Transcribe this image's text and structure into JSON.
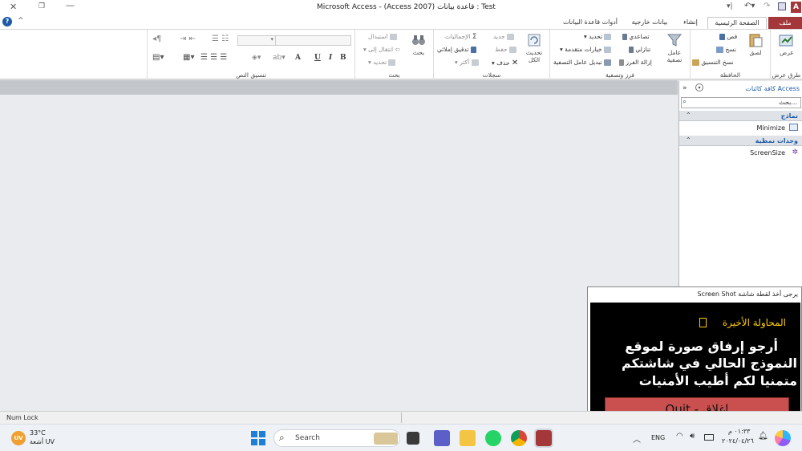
{
  "window": {
    "title": "Microsoft Access - (Access 2007) قاعدة بيانات : Test",
    "help": "?",
    "caret": "^"
  },
  "tabs": [
    {
      "label": "ملف"
    },
    {
      "label": "الصفحة الرئيسية"
    },
    {
      "label": "إنشاء"
    },
    {
      "label": "بيانات خارجية"
    },
    {
      "label": "أدوات قاعدة البيانات"
    }
  ],
  "ribbon": {
    "views": {
      "group": "طرق عرض",
      "view": "عرض"
    },
    "clipboard": {
      "group": "الحافظة",
      "paste": "لصق",
      "cut": "قص",
      "copy": "نسخ",
      "format_painter": "نسخ التنسيق"
    },
    "sort": {
      "group": "فرز وتصفية",
      "filter": "عامل تصفية",
      "ascending": "تصاعدي",
      "descending": "تنازلي",
      "remove_sort": "إزالة الفرز",
      "selection": "تحديد",
      "advanced": "خيارات متقدمة",
      "toggle_filter": "تبديل عامل التصفية"
    },
    "records": {
      "group": "سجلات",
      "refresh": "تحديث الكل",
      "new": "جديد",
      "save": "حفظ",
      "delete": "حذف",
      "totals": "الإجماليات",
      "spelling": "تدقيق إملائي",
      "more": "أكثر"
    },
    "find": {
      "group": "بحث",
      "find": "بحث",
      "replace": "استبدال",
      "goto": "انتقال إلى",
      "select": "تحديد"
    },
    "text": {
      "group": "تنسيق النص",
      "bold": "B",
      "italic": "I",
      "underline": "U",
      "font_a": "A"
    }
  },
  "nav": {
    "title": "كافة كائنات Access",
    "search_placeholder": "بحث...",
    "sections": [
      {
        "label": "نماذج",
        "items": [
          "Minimize"
        ]
      },
      {
        "label": "وحدات نمطية",
        "items": [
          "ScreenSize"
        ]
      }
    ]
  },
  "popup": {
    "title": "Screen Shot يرجى أخذ لقطة شاشة",
    "attempt": "المحاولة الأخيرة",
    "message_line1": "أرجو إرفاق صورة لموقع",
    "message_line2": "النموذج الحالي في شاشتكم",
    "message_line3": "متمنيا لكم أطيب الأمنيات",
    "quit": "Quit - إغلاق"
  },
  "status": {
    "numlock": "Num Lock"
  },
  "taskbar": {
    "temp": "33°C",
    "weather": "أشعة UV",
    "uv_badge": "UV",
    "search": "Search",
    "lang": "ENG",
    "time": "٠١:٣٣ م",
    "date": "٢٠٢٤/٠٤/٢٦"
  },
  "colors": {
    "file_tab": "#a4373a",
    "popup_text": "#ffcc00",
    "quit_button": "#c9504f"
  }
}
